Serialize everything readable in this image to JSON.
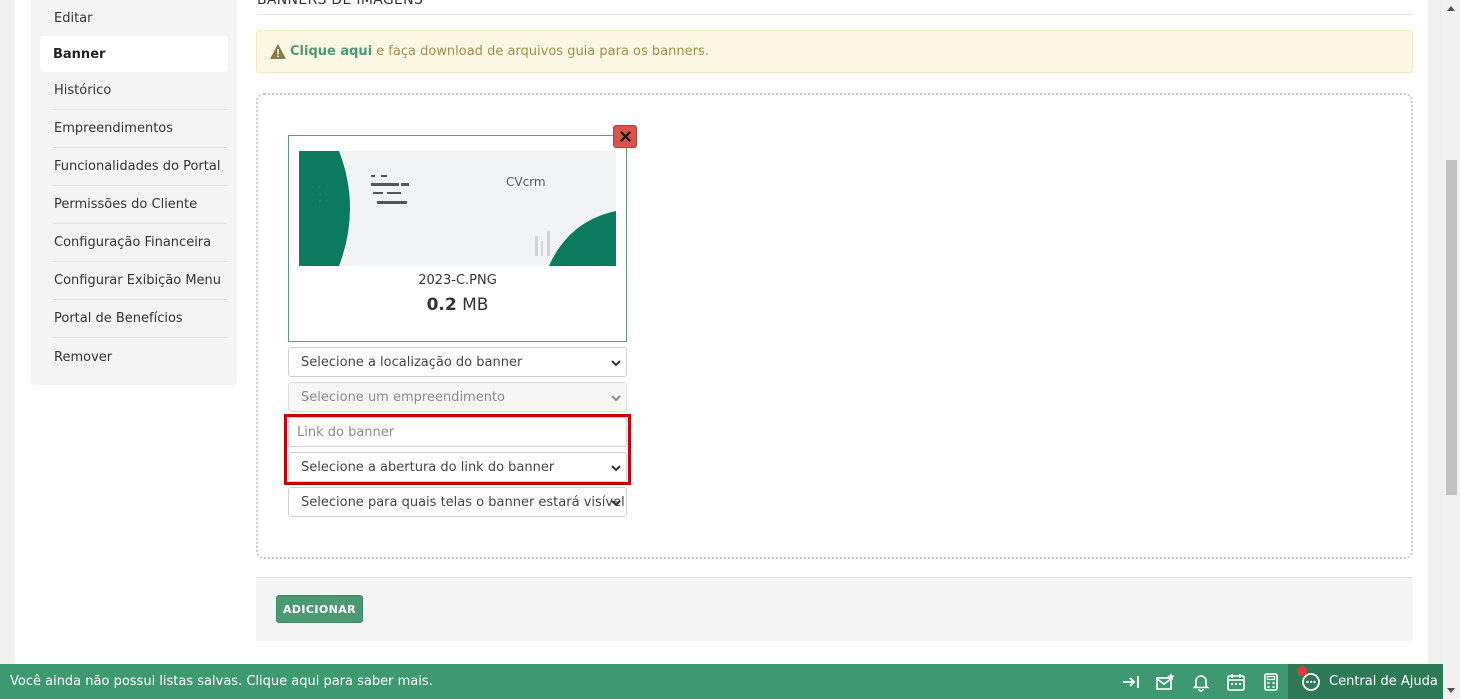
{
  "sidebar": {
    "items": [
      {
        "label": "Editar",
        "active": false
      },
      {
        "label": "Banner",
        "active": true
      },
      {
        "label": "Histórico",
        "active": false
      },
      {
        "label": "Empreendimentos",
        "active": false
      },
      {
        "label": "Funcionalidades do Portal",
        "active": false
      },
      {
        "label": "Permissões do Cliente",
        "active": false
      },
      {
        "label": "Configuração Financeira",
        "active": false
      },
      {
        "label": "Configurar Exibição Menu",
        "active": false
      },
      {
        "label": "Portal de Benefícios",
        "active": false
      },
      {
        "label": "Remover",
        "active": false
      }
    ]
  },
  "main": {
    "section_title": "BANNERS DE IMAGENS",
    "alert": {
      "link_text": "Clique aqui",
      "text": "e faça download de arquivos guia para os banners."
    },
    "upload": {
      "file_name": "2023-C.PNG",
      "file_size_value": "0.2",
      "file_size_unit": "MB",
      "thumb_logo": "CVcrm"
    },
    "form": {
      "location_select": "Selecione a localização do banner",
      "enterprise_select": "Selecione um empreendimento",
      "link_placeholder": "Link do banner",
      "link_open_select": "Selecione a abertura do link do banner",
      "screens_select": "Selecione para quais telas o banner estará visível"
    },
    "add_button": "ADICIONAR"
  },
  "bottombar": {
    "message": "Você ainda não possui listas salvas. Clique aqui para saber mais.",
    "help_label": "Central de Ajuda"
  },
  "colors": {
    "brand_green": "#3f9970",
    "dark_green": "#2e7a56",
    "danger": "#d9534f",
    "highlight": "#cc0000",
    "alert_bg": "#fcf8e3"
  }
}
